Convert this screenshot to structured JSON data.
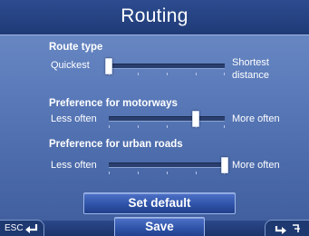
{
  "title": "Routing",
  "route_type": {
    "label": "Route type",
    "left_label": "Quickest",
    "right_label_line1": "Shortest",
    "right_label_line2": "distance",
    "value": 0.0
  },
  "motorways": {
    "label": "Preference for motorways",
    "left_label": "Less often",
    "right_label": "More often",
    "value": 0.75
  },
  "urban_roads": {
    "label": "Preference for urban roads",
    "left_label": "Less often",
    "right_label": "More often",
    "value": 1.0
  },
  "buttons": {
    "set_default": "Set default",
    "save": "Save"
  },
  "nav": {
    "esc_label": "ESC",
    "back_icon": "return-arrow-icon",
    "right_icon": "forward-arrow-icon"
  }
}
